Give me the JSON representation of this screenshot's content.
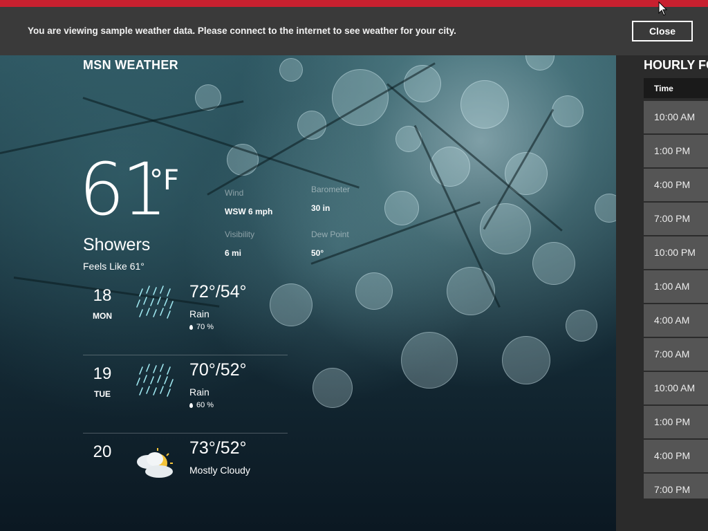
{
  "notice": {
    "message": "You are viewing sample weather data. Please connect to the internet to see weather for your city.",
    "close_label": "Close"
  },
  "app": {
    "title": "MSN WEATHER"
  },
  "current": {
    "temperature": "61",
    "unit": "°F",
    "condition": "Showers",
    "feels_like": "Feels Like 61°",
    "stats": [
      {
        "label": "Wind",
        "value": "WSW 6 mph"
      },
      {
        "label": "Barometer",
        "value": "30 in"
      },
      {
        "label": "Visibility",
        "value": "6 mi"
      },
      {
        "label": "Dew Point",
        "value": "50°"
      }
    ]
  },
  "forecast": [
    {
      "day": "18",
      "weekday": "MON",
      "temps": "72°/54°",
      "condition": "Rain",
      "precip": "70 %",
      "icon": "rain-icon"
    },
    {
      "day": "19",
      "weekday": "TUE",
      "temps": "70°/52°",
      "condition": "Rain",
      "precip": "60 %",
      "icon": "rain-icon"
    },
    {
      "day": "20",
      "weekday": "",
      "temps": "73°/52°",
      "condition": "Mostly Cloudy",
      "precip": "",
      "icon": "partly-cloudy-icon"
    }
  ],
  "hourly": {
    "title": "HOURLY FO",
    "header": "Time",
    "times": [
      "10:00 AM",
      "1:00 PM",
      "4:00 PM",
      "7:00 PM",
      "10:00 PM",
      "1:00 AM",
      "4:00 AM",
      "7:00 AM",
      "10:00 AM",
      "1:00 PM",
      "4:00 PM",
      "7:00 PM"
    ]
  },
  "colors": {
    "accent": "#c8202f",
    "notice_bg": "#3a3a3a",
    "hour_row_bg": "#555555"
  }
}
